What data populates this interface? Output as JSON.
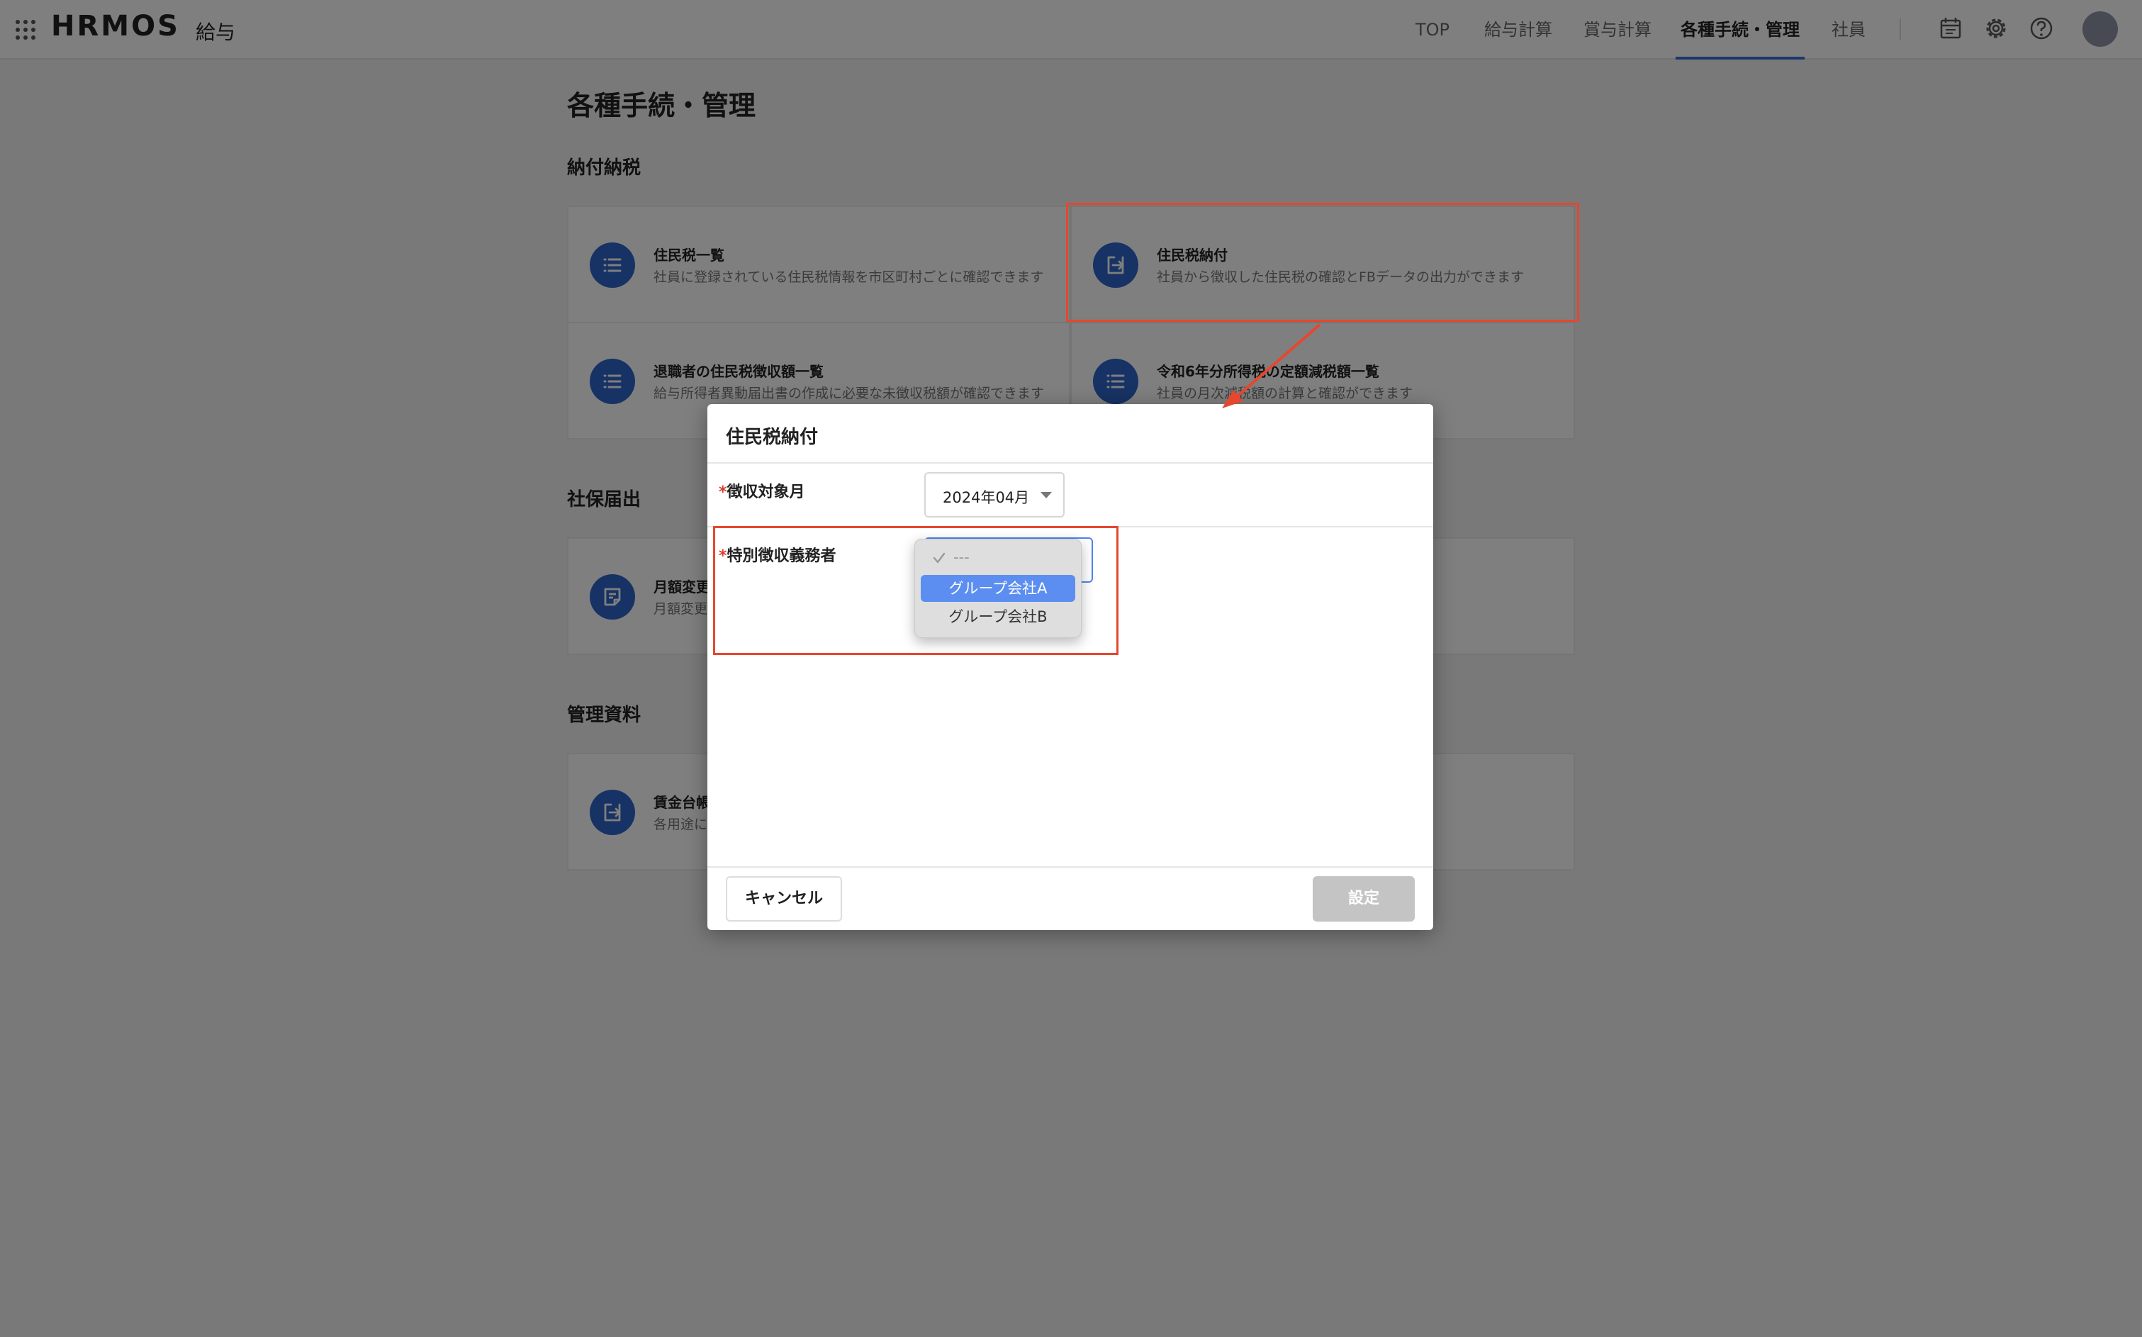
{
  "header": {
    "logo": "HRMOS",
    "logo_sub": "給与",
    "nav": [
      "TOP",
      "給与計算",
      "賞与計算",
      "各種手続・管理",
      "社員"
    ],
    "active_nav": "各種手続・管理",
    "icons": [
      "apps-grid-icon",
      "calendar-icon",
      "gear-icon",
      "help-icon",
      "avatar"
    ]
  },
  "page": {
    "title": "各種手続・管理",
    "sections": [
      {
        "title": "納付納税",
        "cards": [
          {
            "title": "住民税一覧",
            "desc": "社員に登録されている住民税情報を市区町村ごとに確認できます",
            "icon": "list-icon"
          },
          {
            "title": "住民税納付",
            "desc": "社員から徴収した住民税の確認とFBデータの出力ができます",
            "icon": "export-icon"
          },
          {
            "title": "退職者の住民税徴収額一覧",
            "desc": "給与所得者異動届出書の作成に必要な未徴収税額が確認できます",
            "icon": "list-icon"
          },
          {
            "title": "令和6年分所得税の定額減税額一覧",
            "desc": "社員の月次減税額の計算と確認ができます",
            "icon": "list-icon"
          }
        ]
      },
      {
        "title": "社保届出",
        "cards": [
          {
            "title": "月額変更",
            "desc": "月額変更",
            "icon": "document-icon"
          }
        ]
      },
      {
        "title": "管理資料",
        "cards": [
          {
            "title": "賃金台帳",
            "desc": "各用途に",
            "icon": "export-icon"
          }
        ]
      }
    ]
  },
  "modal": {
    "title": "住民税納付",
    "fields": [
      {
        "label": "徴収対象月",
        "required_mark": "*",
        "value": "2024年04月"
      },
      {
        "label": "特別徴収義務者",
        "required_mark": "*",
        "value": ""
      }
    ],
    "dropdown_options": [
      "---",
      "グループ会社A",
      "グループ会社B"
    ],
    "highlighted_option": "グループ会社A",
    "cancel_label": "キャンセル",
    "submit_label": "設定"
  },
  "colors": {
    "accent": "#2f64c8",
    "annotation": "#e5472f",
    "highlight": "#5b8ef0",
    "disabled_button": "#c4c4c4"
  }
}
